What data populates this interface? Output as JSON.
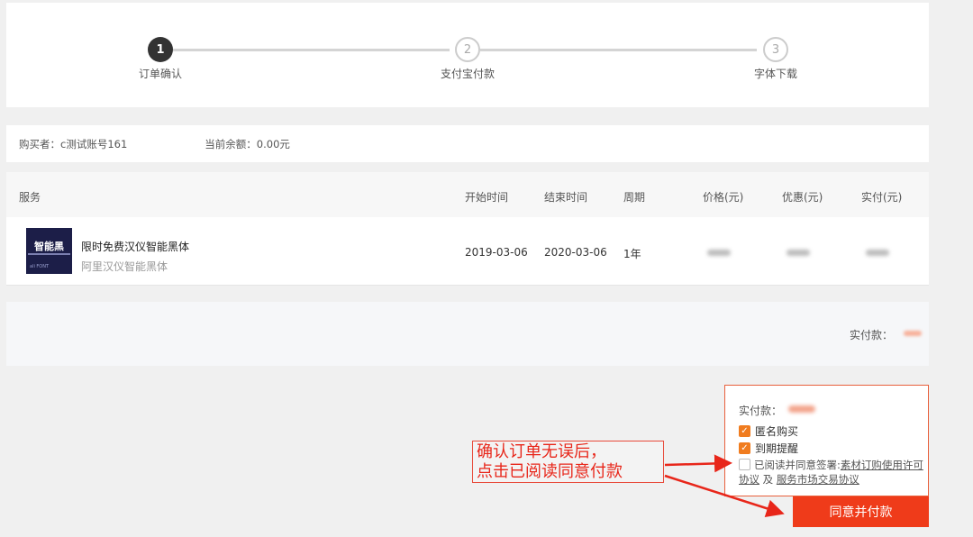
{
  "steps": [
    {
      "number": "1",
      "label": "订单确认",
      "state": "active"
    },
    {
      "number": "2",
      "label": "支付宝付款",
      "state": "todo"
    },
    {
      "number": "3",
      "label": "字体下载",
      "state": "todo"
    }
  ],
  "buyer": {
    "buyer_text": "购买者：c测试账号161",
    "balance_text": "当前余额：0.00元"
  },
  "table": {
    "headers": [
      "服务",
      "开始时间",
      "结束时间",
      "周期",
      "价格(元)",
      "优惠(元)",
      "实付(元)"
    ],
    "row": {
      "thumb_title": "智能黑",
      "thumb_brand": "ali FONT",
      "name": "限时免费汉仪智能黑体",
      "subtitle": "阿里汉仪智能黑体",
      "start": "2019-03-06",
      "end": "2020-03-06",
      "period": "1年"
    }
  },
  "summary": {
    "paid_label": "实付款："
  },
  "paybox": {
    "total_label": "实付款：",
    "anonymous_label": "匿名购买",
    "reminder_label": "到期提醒",
    "agree_prefix": "已阅读并同意签署:",
    "agree_link1": "素材订购使用许可协议",
    "agree_and": "及",
    "agree_link2": "服务市场交易协议",
    "button_label": "同意并付款"
  },
  "annotation": {
    "line1": "确认订单无误后，",
    "line2": "点击已阅读同意付款"
  },
  "colors": {
    "accent": "#ef3b1a",
    "checkbox": "#f07c1f",
    "annotation": "#e8261a"
  }
}
